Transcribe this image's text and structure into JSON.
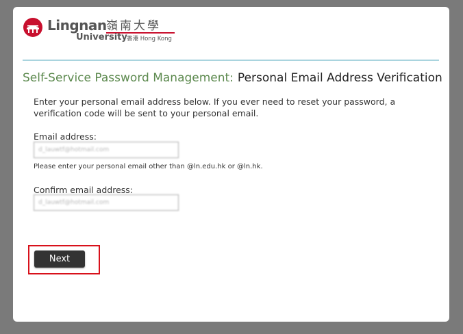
{
  "logo": {
    "name": "Lingnan",
    "name_cjk": "嶺南大學",
    "subtitle": "University",
    "subtitle_small": "香港 Hong Kong"
  },
  "header": {
    "section": "Self-Service Password Management:",
    "title": "Personal Email Address Verification"
  },
  "intro": "Enter your personal email address below. If you ever need to reset your password, a verification code will be sent to your personal email.",
  "form": {
    "email_label": "Email address:",
    "email_value": "d_lauwtf@hotmail.com",
    "email_hint": "Please enter your personal email other than @ln.edu.hk or @ln.hk.",
    "confirm_label": "Confirm email address:",
    "confirm_value": "d_lauwtf@hotmail.com"
  },
  "buttons": {
    "next": "Next"
  },
  "colors": {
    "brand_red": "#c8102e",
    "heading_green": "#5d8a4f",
    "divider": "#a9d4de",
    "highlight": "#d8111b",
    "button": "#333333"
  }
}
